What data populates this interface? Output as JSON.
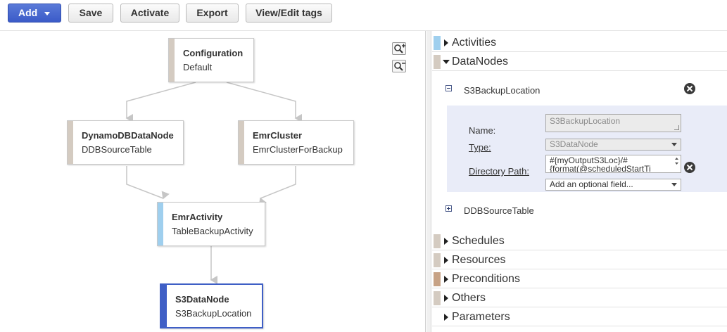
{
  "toolbar": {
    "add_label": "Add",
    "save_label": "Save",
    "activate_label": "Activate",
    "export_label": "Export",
    "tags_label": "View/Edit tags"
  },
  "colors": {
    "accent": "#3f5fc6",
    "node_bar": "#d4cbc1",
    "activity_bar": "#9fcfee",
    "preconditions_bar": "#c7a285"
  },
  "graph": {
    "nodes": [
      {
        "type": "Configuration",
        "name": "Default"
      },
      {
        "type": "DynamoDBDataNode",
        "name": "DDBSourceTable"
      },
      {
        "type": "EmrCluster",
        "name": "EmrClusterForBackup"
      },
      {
        "type": "EmrActivity",
        "name": "TableBackupActivity"
      },
      {
        "type": "S3DataNode",
        "name": "S3BackupLocation"
      }
    ],
    "zoom_in_icon": "zoom-in-icon",
    "zoom_out_icon": "zoom-out-icon"
  },
  "panel": {
    "sections": [
      {
        "label": "Activities"
      },
      {
        "label": "DataNodes"
      },
      {
        "label": "Schedules"
      },
      {
        "label": "Resources"
      },
      {
        "label": "Preconditions"
      },
      {
        "label": "Others"
      },
      {
        "label": "Parameters"
      }
    ],
    "datanodes": {
      "expanded_item": "S3BackupLocation",
      "collapsed_item": "DDBSourceTable",
      "form": {
        "name_label": "Name:",
        "name_value": "S3BackupLocation",
        "type_label": "Type:",
        "type_value": "S3DataNode",
        "dirpath_label": "Directory Path:",
        "dirpath_line1": "#{myOutputS3Loc}/#",
        "dirpath_line2": "{format(@scheduledStartTi",
        "optional_field": "Add an optional field..."
      }
    }
  }
}
